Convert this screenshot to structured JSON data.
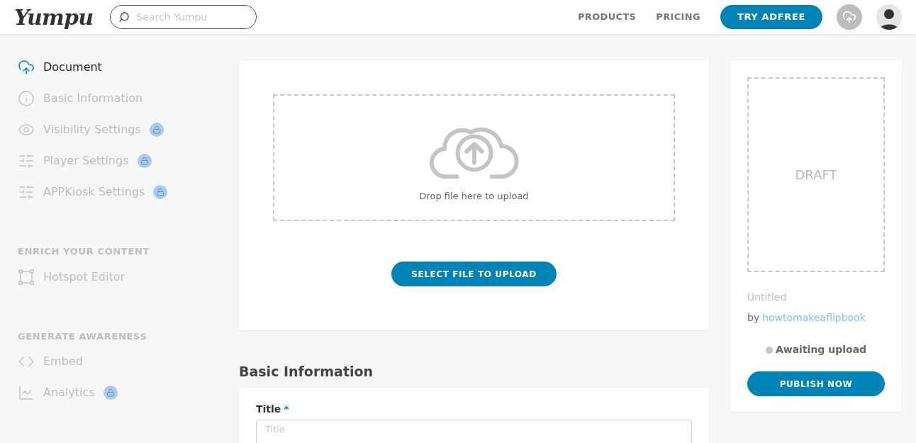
{
  "header": {
    "logo": "Yumpu",
    "search": {
      "placeholder": "Search Yumpu"
    },
    "nav": [
      "PRODUCTS",
      "PRICING"
    ],
    "cta": "TRY ADFREE"
  },
  "sidebar": {
    "items": [
      {
        "label": "Document",
        "selected": true,
        "locked": false
      },
      {
        "label": "Basic Information",
        "selected": false,
        "locked": false
      },
      {
        "label": "Visibility Settings",
        "selected": false,
        "locked": true
      },
      {
        "label": "Player Settings",
        "selected": false,
        "locked": true
      },
      {
        "label": "APPKiosk Settings",
        "selected": false,
        "locked": true
      }
    ],
    "sections": [
      {
        "title": "ENRICH YOUR CONTENT",
        "items": [
          {
            "label": "Hotspot Editor",
            "selected": false,
            "locked": false
          }
        ]
      },
      {
        "title": "GENERATE AWARENESS",
        "items": [
          {
            "label": "Embed",
            "selected": false,
            "locked": false
          },
          {
            "label": "Analytics",
            "selected": false,
            "locked": true
          }
        ]
      }
    ]
  },
  "upload": {
    "drop_text": "Drop file here to upload",
    "button": "SELECT FILE TO UPLOAD"
  },
  "basic_information": {
    "heading": "Basic Information",
    "field": {
      "label": "Title",
      "required_mark": "*",
      "placeholder": "Title"
    }
  },
  "preview": {
    "cover": "DRAFT",
    "title": "Untitled",
    "by": "by",
    "author": "howtomakeaflipbook",
    "status": "Awaiting upload",
    "button": "PUBLISH NOW"
  }
}
